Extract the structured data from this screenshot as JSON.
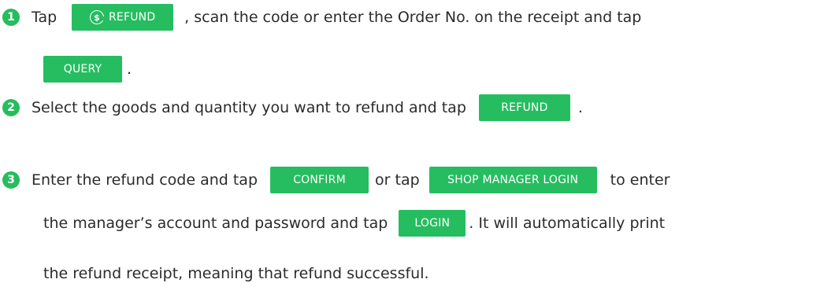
{
  "steps": [
    {
      "number": "1",
      "parts": {
        "t1": "Tap",
        "b1": "REFUND",
        "t2": ", scan the code or enter the Order No. on the receipt and tap",
        "b2": "QUERY",
        "t3": "."
      }
    },
    {
      "number": "2",
      "parts": {
        "t1": "Select the goods and quantity you want to refund and tap",
        "b1": "REFUND",
        "t2": "."
      }
    },
    {
      "number": "3",
      "parts": {
        "t1": "Enter the refund code and tap",
        "b1": "CONFIRM",
        "t2": "or tap",
        "b2": "SHOP MANAGER LOGIN",
        "t3": "to enter",
        "t4": "the manager’s account and password and tap",
        "b3": "LOGIN",
        "t5": ". It will automatically print",
        "t6": "the refund receipt, meaning that refund successful."
      }
    }
  ],
  "icons": {
    "refund_button_icon": "dollar-refund-icon"
  },
  "colors": {
    "accent": "#26bd60",
    "text": "#2b2b2b",
    "button_text": "#ffffff"
  }
}
